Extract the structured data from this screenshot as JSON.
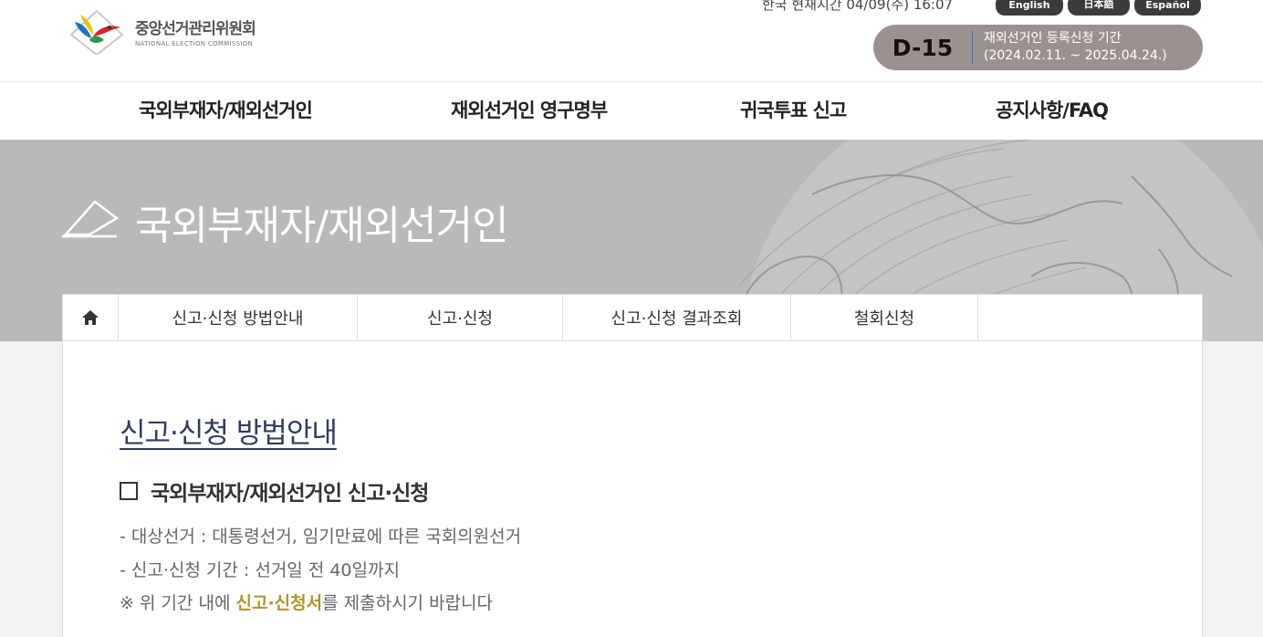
{
  "header": {
    "logo_ko": "중앙선거관리위원회",
    "logo_en": "NATIONAL ELECTION COMMISSION",
    "clock": "한국 현재시간 04/09(주) 16:07",
    "languages": [
      "English",
      "日本語",
      "Español"
    ],
    "dday": {
      "count": "D-15",
      "label": "재외선거인 등록신청 기간",
      "period": "(2024.02.11. ~ 2025.04.24.)"
    }
  },
  "nav": {
    "items": [
      "국외부재자/재외선거인",
      "재외선거인 영구명부",
      "귀국투표 신고",
      "공지사항/FAQ"
    ]
  },
  "banner": {
    "title": "국외부재자/재외선거인"
  },
  "subnav": {
    "items": [
      "신고·신청 방법안내",
      "신고·신청",
      "신고·신청 결과조회",
      "철회신청"
    ]
  },
  "main": {
    "page_title": "신고·신청 방법안내",
    "section_title": "국외부재자/재외선거인 신고·신청",
    "line1": "- 대상선거 : 대통령선거, 임기만료에 따른 국회의원선거",
    "line2": "- 신고·신청 기간 : 선거일 전 40일까지",
    "line3_prefix": "※ 위 기간 내에 ",
    "line3_highlight": "신고·신청서",
    "line3_suffix": "를 제출하시기 바랍니다"
  },
  "colors": {
    "banner_bg": "#b9b9b9",
    "dday_bg": "#9b928f",
    "accent_gold": "#b2932c",
    "title_navy": "#2e3d60"
  },
  "icons": [
    "nec-logo-icon",
    "home-icon",
    "ballot-pencil-icon",
    "checkbox-square-icon",
    "globe-decoration"
  ]
}
